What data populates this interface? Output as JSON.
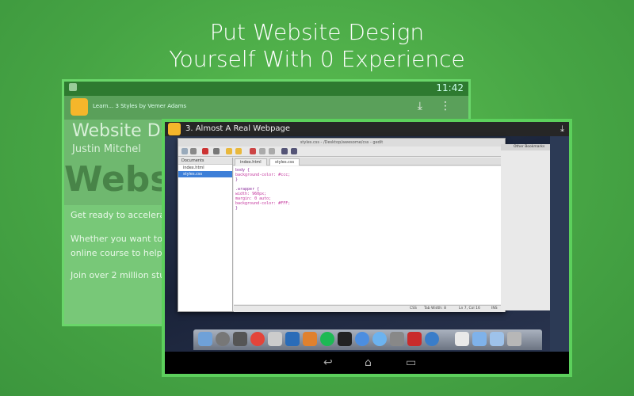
{
  "headline": {
    "line1": "Put Website Design",
    "line2": "Yourself With 0 Experience"
  },
  "back_screen": {
    "status_time": "11:42",
    "action_subtitle": "Learn... 3 Styles by Vemer Adams",
    "hero_title": "Website Design",
    "hero_author": "Justin Mitchel",
    "hero_watermark": "Website",
    "body_lines": [
      "Get ready to accelerate you",
      "Whether you want to start a",
      "online course to help you ge",
      "Join over 2 million students"
    ]
  },
  "front_screen": {
    "title": "3. Almost A Real Webpage",
    "editor": {
      "window_title": "styles.css - /Desktop/awesome/css - gedit",
      "sidebar_header": "Documents",
      "files": [
        "index.html",
        "styles.css"
      ],
      "tabs": [
        "index.html",
        "styles.css"
      ],
      "code_lines": [
        "body {",
        "background-color: #ccc;",
        "}",
        "",
        ".wrapper {",
        "width: 960px;",
        "margin: 0 auto;",
        "background-color: #FFF;",
        "}"
      ],
      "status": {
        "lang": "CSS",
        "tab_width": "Tab Width: 8",
        "position": "Ln 7, Col 16",
        "mode": "INS"
      }
    },
    "browser_bookmark": "Other Bookmarks"
  },
  "colors": {
    "background": "#4aa84a",
    "tablet_frame": "#5cd05c",
    "accent": "#f5b62b"
  }
}
